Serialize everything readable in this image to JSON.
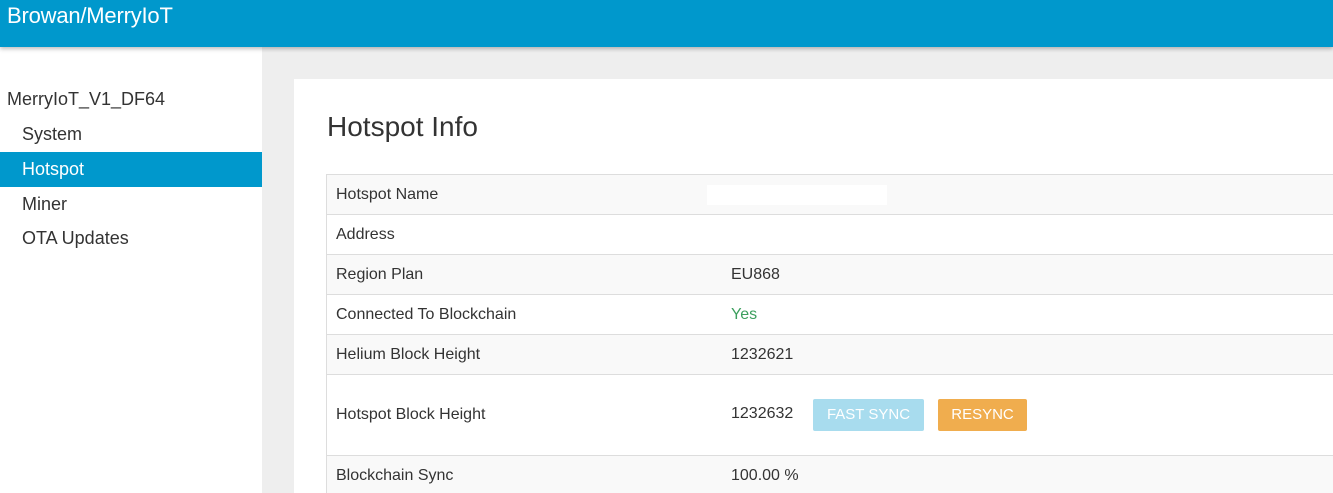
{
  "header": {
    "brand": "Browan/MerryIoT"
  },
  "sidebar": {
    "device_name": "MerryIoT_V1_DF64",
    "items": [
      {
        "label": "System",
        "active": false
      },
      {
        "label": "Hotspot",
        "active": true
      },
      {
        "label": "Miner",
        "active": false
      },
      {
        "label": "OTA Updates",
        "active": false
      }
    ]
  },
  "main": {
    "title": "Hotspot Info",
    "rows": [
      {
        "label": "Hotspot Name",
        "value": ""
      },
      {
        "label": "Address",
        "value": ""
      },
      {
        "label": "Region Plan",
        "value": "EU868"
      },
      {
        "label": "Connected To Blockchain",
        "value": "Yes"
      },
      {
        "label": "Helium Block Height",
        "value": "1232621"
      },
      {
        "label": "Hotspot Block Height",
        "value": "1232632"
      },
      {
        "label": "Blockchain Sync",
        "value": "100.00 %"
      }
    ],
    "buttons": {
      "fast_sync": "FAST SYNC",
      "resync": "RESYNC"
    }
  },
  "colors": {
    "header": "#0098cc",
    "active_nav": "#0098cc",
    "fast_sync": "#a8dcee",
    "resync": "#f0ad4e",
    "success_text": "#3c9f5e"
  }
}
